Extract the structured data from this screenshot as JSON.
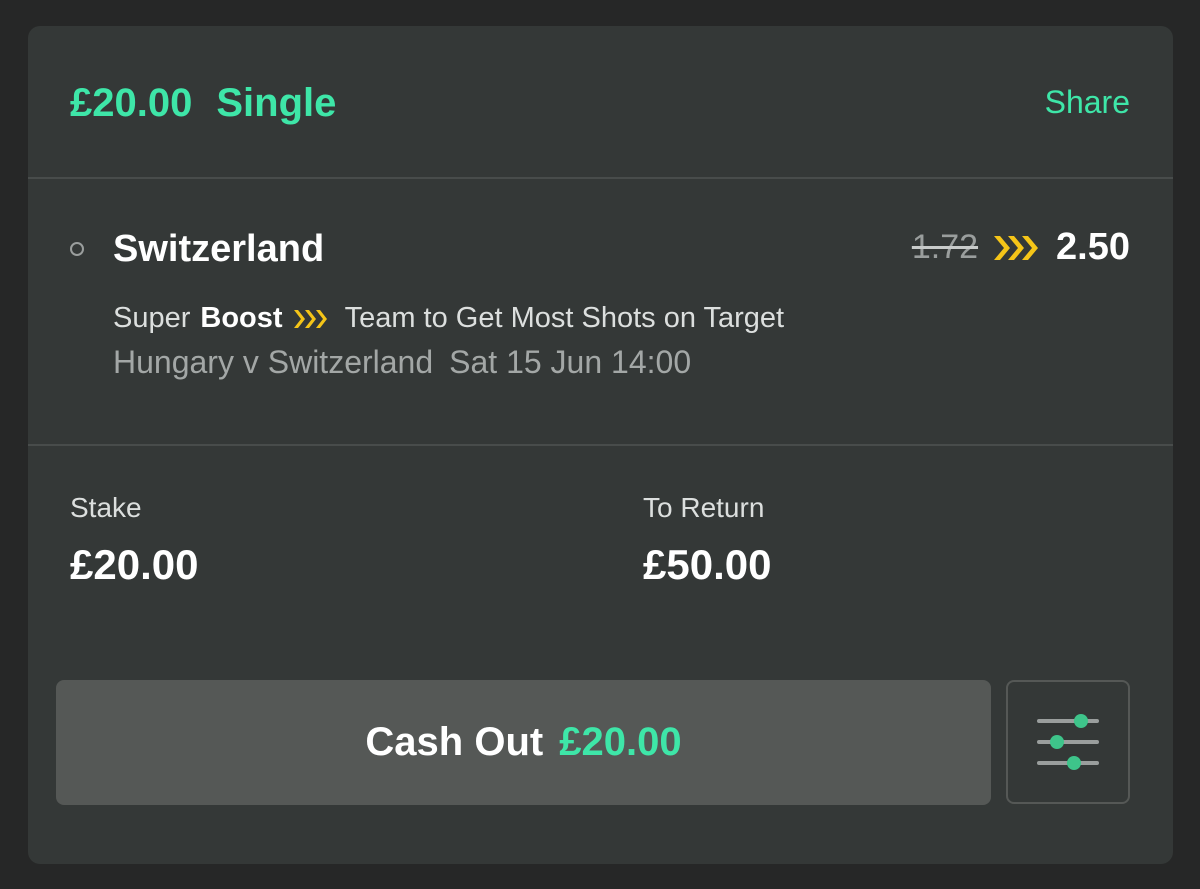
{
  "header": {
    "stake_text": "£20.00",
    "bet_type": "Single",
    "share_label": "Share"
  },
  "selection": {
    "name": "Switzerland",
    "old_odds": "1.72",
    "new_odds": "2.50",
    "market_prefix": "Super",
    "market_boost": "Boost",
    "market_name": "Team to Get Most Shots on Target",
    "event_name": "Hungary v Switzerland",
    "event_time": "Sat 15 Jun 14:00"
  },
  "summary": {
    "stake_label": "Stake",
    "stake_value": "£20.00",
    "return_label": "To Return",
    "return_value": "£50.00"
  },
  "actions": {
    "cashout_label": "Cash Out",
    "cashout_value": "£20.00"
  },
  "icons": {
    "boost": "chevron-triple-icon",
    "settings": "sliders-icon",
    "status": "circle-icon"
  },
  "colors": {
    "accent": "#3ee6a8",
    "boost": "#f5c518",
    "background": "#343837"
  }
}
